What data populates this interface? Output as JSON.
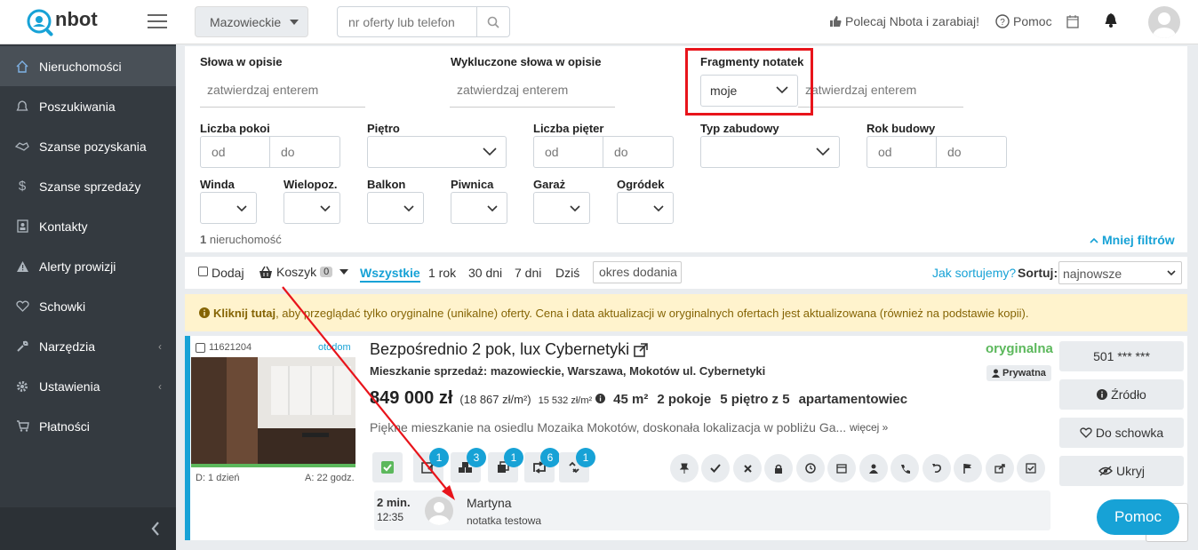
{
  "brand": {
    "logo_text": "nbot"
  },
  "topbar": {
    "region": "Mazowieckie",
    "search_placeholder": "nr oferty lub telefon",
    "recommend": "Polecaj Nbota i zarabiaj!",
    "help": "Pomoc"
  },
  "sidebar": {
    "items": [
      {
        "label": "Nieruchomości",
        "icon": "home-icon",
        "active": true
      },
      {
        "label": "Poszukiwania",
        "icon": "bell-icon"
      },
      {
        "label": "Szanse pozyskania",
        "icon": "handshake-icon"
      },
      {
        "label": "Szanse sprzedaży",
        "icon": "dollar-icon"
      },
      {
        "label": "Kontakty",
        "icon": "contact-card-icon"
      },
      {
        "label": "Alerty prowizji",
        "icon": "warning-icon"
      },
      {
        "label": "Schowki",
        "icon": "heart-icon"
      },
      {
        "label": "Narzędzia",
        "icon": "wrench-icon",
        "has_children": true
      },
      {
        "label": "Ustawienia",
        "icon": "gear-icon",
        "has_children": true
      },
      {
        "label": "Płatności",
        "icon": "cart-icon"
      }
    ]
  },
  "filters": {
    "words_label": "Słowa w opisie",
    "words_placeholder": "zatwierdzaj enterem",
    "excluded_label": "Wykluczone słowa w opisie",
    "excluded_placeholder": "zatwierdzaj enterem",
    "notes_label": "Fragmenty notatek",
    "notes_select": "moje",
    "notes_placeholder": "zatwierdzaj enterem",
    "rooms_label": "Liczba pokoi",
    "floor_label": "Piętro",
    "floors_label": "Liczba pięter",
    "building_label": "Typ zabudowy",
    "year_label": "Rok budowy",
    "from": "od",
    "to": "do",
    "elevator": "Winda",
    "multilevel": "Wielopoz.",
    "balcony": "Balkon",
    "basement": "Piwnica",
    "garage": "Garaż",
    "garden": "Ogródek",
    "count": "1",
    "count_suffix": "nieruchomość",
    "less_filters": "Mniej filtrów"
  },
  "toolbar": {
    "add": "Dodaj",
    "basket": "Koszyk",
    "basket_count": "0",
    "all": "Wszystkie",
    "year": "1 rok",
    "days30": "30 dni",
    "days7": "7 dni",
    "today": "Dziś",
    "period": "okres dodania",
    "how_sort": "Jak sortujemy?",
    "sort_label": "Sortuj:",
    "sort_value": "najnowsze"
  },
  "alert": {
    "bold": "Kliknij tutaj",
    "text": ", aby przeglądać tylko oryginalne (unikalne) oferty. Cena i data aktualizacji w oryginalnych ofertach jest aktualizowana (również na podstawie kopii)."
  },
  "listing": {
    "id": "11621204",
    "source": "otodom",
    "title": "Bezpośrednio 2 pok, lux Cybernetyki",
    "original": "oryginalna",
    "subtitle": "Mieszkanie sprzedaż: mazowieckie, Warszawa, Mokotów ul. Cybernetyki",
    "private": "Prywatna",
    "price": "849 000 zł",
    "price_m2": "(18 867 zł/m²)",
    "avg_m2": "15 532 zł/m²",
    "area": "45 m²",
    "rooms": "2 pokoje",
    "floor": "5 piętro z 5",
    "type": "apartamentowiec",
    "description": "Piękne mieszkanie na osiedlu Mozaika Mokotów, doskonała lokalizacja w pobliżu Ga...",
    "more": "więcej »",
    "date_added": "D: 1 dzień",
    "date_updated": "A: 22 godz.",
    "badges": [
      "1",
      "3",
      "1",
      "6",
      "1"
    ],
    "phone": "501 *** ***",
    "source_btn": "Źródło",
    "save_btn": "Do schowka",
    "hide_btn": "Ukryj",
    "note_time": "2 min.",
    "note_clock": "12:35",
    "note_author": "Martyna",
    "note_text": "notatka testowa"
  },
  "help_button": "Pomoc",
  "colors": {
    "accent": "#17a2d6",
    "sidebar": "#343a40",
    "original": "#5cb85c",
    "annotation": "#e8141b"
  }
}
